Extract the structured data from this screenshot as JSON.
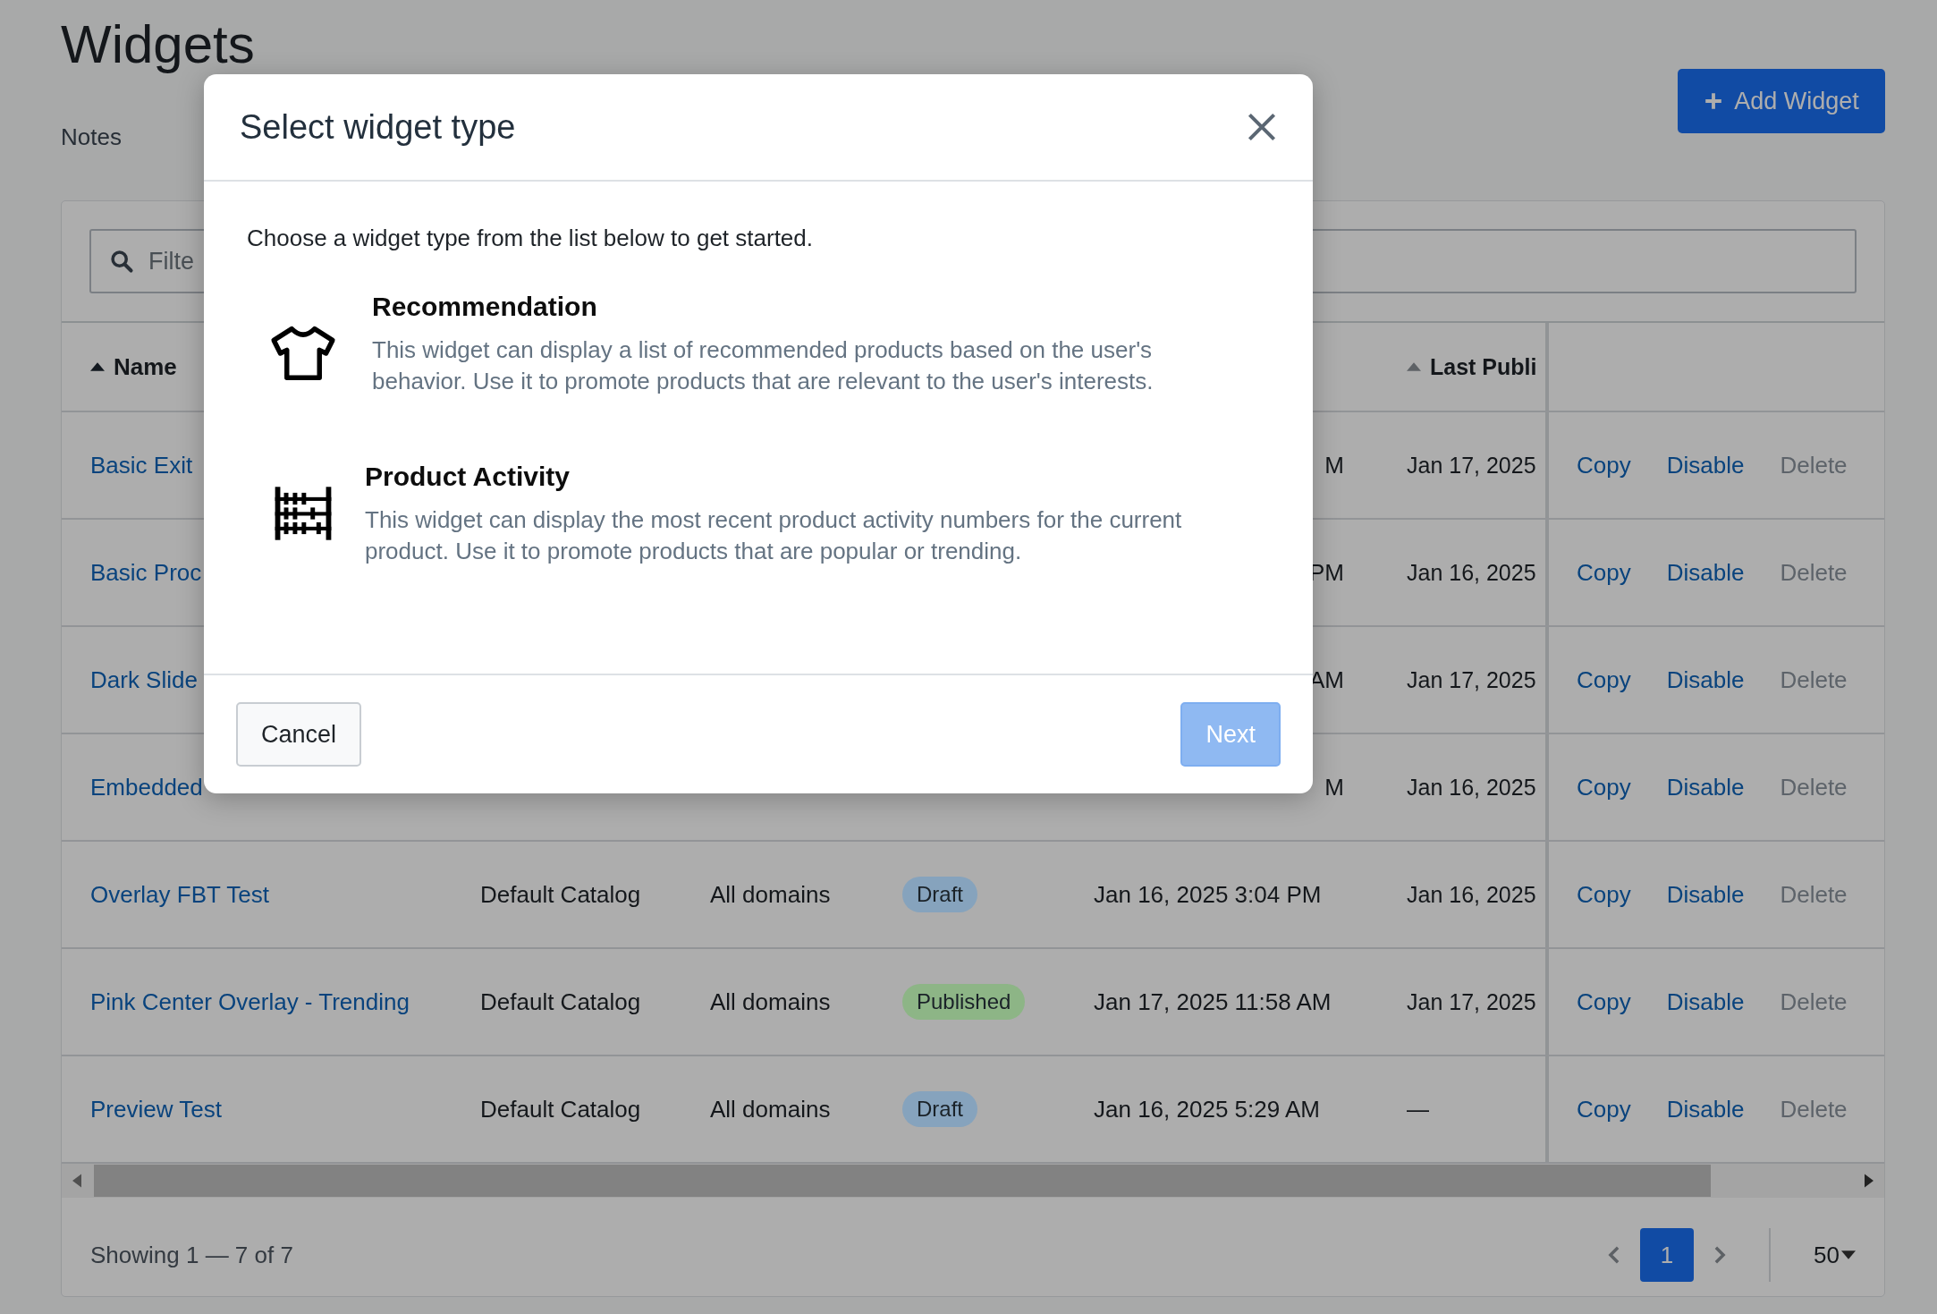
{
  "page": {
    "title": "Widgets",
    "subtitle": "Notes",
    "add_button": "Add Widget"
  },
  "filter": {
    "placeholder": "Filte"
  },
  "table": {
    "columns": [
      {
        "label": "Name",
        "sort_active": true
      },
      {
        "label": "Last Publi",
        "sort_active": false
      }
    ],
    "rows": [
      {
        "name": "Basic Exit",
        "first_published": "M",
        "last_published": "Jan 17, 2025",
        "actions": [
          {
            "label": "Copy",
            "disabled": false
          },
          {
            "label": "Disable",
            "disabled": false
          },
          {
            "label": "Delete",
            "disabled": true
          }
        ]
      },
      {
        "name": "Basic Proc",
        "first_published": "PM",
        "last_published": "Jan 16, 2025",
        "actions": [
          {
            "label": "Copy",
            "disabled": false
          },
          {
            "label": "Disable",
            "disabled": false
          },
          {
            "label": "Delete",
            "disabled": true
          }
        ]
      },
      {
        "name": "Dark Slide",
        "first_published": "AM",
        "last_published": "Jan 17, 2025",
        "actions": [
          {
            "label": "Copy",
            "disabled": false
          },
          {
            "label": "Disable",
            "disabled": false
          },
          {
            "label": "Delete",
            "disabled": true
          }
        ]
      },
      {
        "name": "Embedded",
        "first_published": "M",
        "last_published": "Jan 16, 2025",
        "actions": [
          {
            "label": "Copy",
            "disabled": false
          },
          {
            "label": "Disable",
            "disabled": false
          },
          {
            "label": "Delete",
            "disabled": true
          }
        ]
      },
      {
        "name": "Overlay FBT Test",
        "catalog": "Default Catalog",
        "domains": "All domains",
        "status": {
          "label": "Draft",
          "color": "#86a3bd"
        },
        "first_published": "Jan 16, 2025 3:04 PM",
        "last_published": "Jan 16, 2025",
        "actions": [
          {
            "label": "Copy",
            "disabled": false
          },
          {
            "label": "Disable",
            "disabled": false
          },
          {
            "label": "Delete",
            "disabled": true
          }
        ]
      },
      {
        "name": "Pink Center Overlay - Trending",
        "catalog": "Default Catalog",
        "domains": "All domains",
        "status": {
          "label": "Published",
          "color": "#8db586"
        },
        "first_published": "Jan 17, 2025 11:58 AM",
        "last_published": "Jan 17, 2025",
        "actions": [
          {
            "label": "Copy",
            "disabled": false
          },
          {
            "label": "Disable",
            "disabled": false
          },
          {
            "label": "Delete",
            "disabled": true
          }
        ]
      },
      {
        "name": "Preview Test",
        "catalog": "Default Catalog",
        "domains": "All domains",
        "status": {
          "label": "Draft",
          "color": "#86a3bd"
        },
        "first_published": "Jan 16, 2025 5:29 AM",
        "last_published": "—",
        "actions": [
          {
            "label": "Copy",
            "disabled": false
          },
          {
            "label": "Disable",
            "disabled": false
          },
          {
            "label": "Delete",
            "disabled": true
          }
        ]
      }
    ]
  },
  "footer": {
    "summary": "Showing 1 — 7 of 7",
    "pages": [
      {
        "label": "1",
        "selected": true
      }
    ],
    "page_size": "50"
  },
  "modal": {
    "title": "Select widget type",
    "intro": "Choose a widget type from the list below to get started.",
    "options": [
      {
        "kind": "shirt",
        "title": "Recommendation",
        "description": "This widget can display a list of recommended products based on the user's behavior. Use it to promote products that are relevant to the user's interests."
      },
      {
        "kind": "abacus",
        "title": "Product Activity",
        "description": "This widget can display the most recent product activity numbers for the current product. Use it to promote products that are popular or trending."
      }
    ],
    "cancel": {
      "label": "Cancel",
      "disabled": false
    },
    "next": {
      "label": "Next",
      "disabled": true
    }
  }
}
